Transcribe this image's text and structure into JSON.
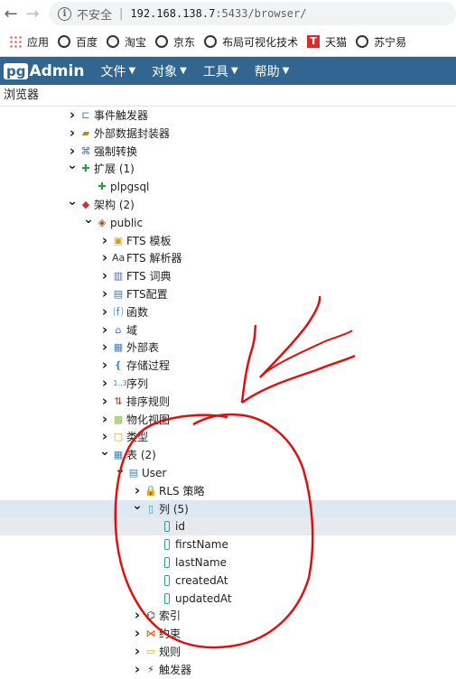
{
  "browser": {
    "insecure_label": "不安全",
    "url_host": "192.168.138.7",
    "url_rest": ":5433/browser/"
  },
  "bookmarks": [
    {
      "label": "应用",
      "icon": "apps-grid-icon"
    },
    {
      "label": "百度",
      "icon": "globe-icon"
    },
    {
      "label": "淘宝",
      "icon": "globe-icon"
    },
    {
      "label": "京东",
      "icon": "globe-icon"
    },
    {
      "label": "布局可视化技术",
      "icon": "globe-icon"
    },
    {
      "label": "天猫",
      "icon": "tmall-icon"
    },
    {
      "label": "苏宁易",
      "icon": "globe-icon"
    }
  ],
  "app": {
    "logo_pg": "pg",
    "logo_admin": "Admin",
    "menus": [
      "文件",
      "对象",
      "工具",
      "帮助"
    ]
  },
  "panel": {
    "title": "浏览器"
  },
  "tree": [
    {
      "label": "事件触发器",
      "icon": "event-trigger-icon",
      "chevron": "right"
    },
    {
      "label": "外部数据封装器",
      "icon": "fdw-icon",
      "chevron": "right"
    },
    {
      "label": "强制转换",
      "icon": "cast-icon",
      "chevron": "right"
    },
    {
      "label": "扩展 (1)",
      "icon": "extension-icon",
      "chevron": "down"
    },
    {
      "label": "plpgsql",
      "icon": "extension-item-icon",
      "chevron": ""
    },
    {
      "label": "架构 (2)",
      "icon": "schemas-icon",
      "chevron": "down"
    },
    {
      "label": "public",
      "icon": "schema-icon",
      "chevron": "down"
    },
    {
      "label": "FTS 模板",
      "icon": "fts-template-icon",
      "chevron": "right"
    },
    {
      "label": "FTS 解析器",
      "icon": "fts-parser-icon",
      "chevron": "right"
    },
    {
      "label": "FTS 词典",
      "icon": "fts-dictionary-icon",
      "chevron": "right"
    },
    {
      "label": "FTS配置",
      "icon": "fts-config-icon",
      "chevron": "right"
    },
    {
      "label": "函数",
      "icon": "function-icon",
      "chevron": "right"
    },
    {
      "label": "域",
      "icon": "domain-icon",
      "chevron": "right"
    },
    {
      "label": "外部表",
      "icon": "foreign-table-icon",
      "chevron": "right"
    },
    {
      "label": "存储过程",
      "icon": "procedure-icon",
      "chevron": "right"
    },
    {
      "label": "序列",
      "icon": "sequence-icon",
      "chevron": "right"
    },
    {
      "label": "排序规则",
      "icon": "collation-icon",
      "chevron": "right"
    },
    {
      "label": "物化视图",
      "icon": "mview-icon",
      "chevron": "right"
    },
    {
      "label": "类型",
      "icon": "type-icon",
      "chevron": "right"
    },
    {
      "label": "表 (2)",
      "icon": "tables-icon",
      "chevron": "down"
    },
    {
      "label": "User",
      "icon": "table-icon",
      "chevron": "down"
    },
    {
      "label": "RLS 策略",
      "icon": "rls-policy-icon",
      "chevron": "right"
    },
    {
      "label": "列 (5)",
      "icon": "columns-icon",
      "chevron": "down"
    },
    {
      "label": "id",
      "icon": "column-icon",
      "chevron": ""
    },
    {
      "label": "firstName",
      "icon": "column-icon",
      "chevron": ""
    },
    {
      "label": "lastName",
      "icon": "column-icon",
      "chevron": ""
    },
    {
      "label": "createdAt",
      "icon": "column-icon",
      "chevron": ""
    },
    {
      "label": "updatedAt",
      "icon": "column-icon",
      "chevron": ""
    },
    {
      "label": "索引",
      "icon": "index-icon",
      "chevron": "right"
    },
    {
      "label": "约束",
      "icon": "constraint-icon",
      "chevron": "right"
    },
    {
      "label": "规则",
      "icon": "rule-icon",
      "chevron": "right"
    },
    {
      "label": "触发器",
      "icon": "trigger-icon",
      "chevron": "right"
    }
  ]
}
